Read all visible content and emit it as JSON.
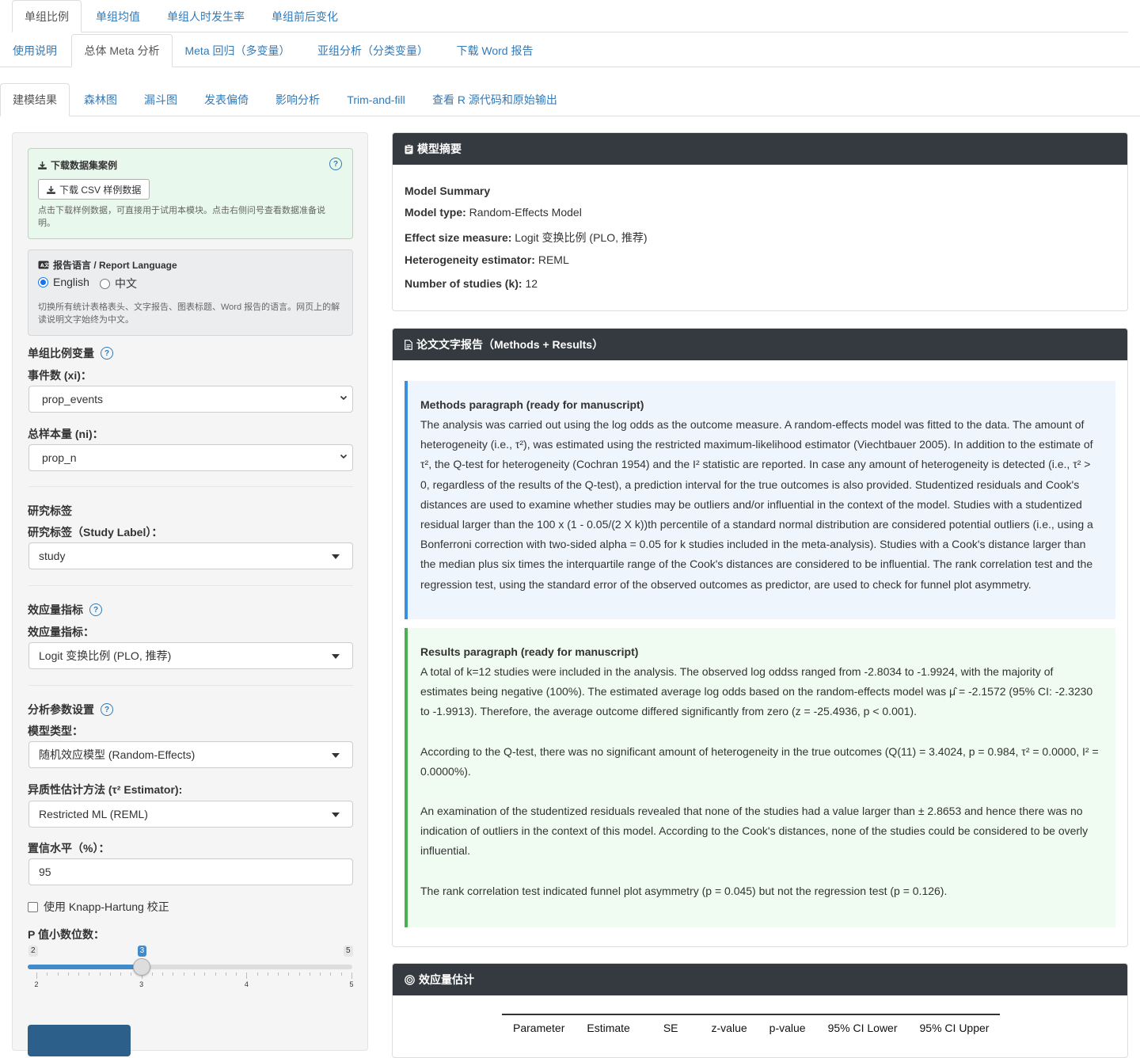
{
  "top_tabs": [
    "单组比例",
    "单组均值",
    "单组人时发生率",
    "单组前后变化"
  ],
  "second_tabs": [
    "使用说明",
    "总体 Meta 分析",
    "Meta 回归（多变量）",
    "亚组分析（分类变量）",
    "下载 Word 报告"
  ],
  "third_tabs": [
    "建模结果",
    "森林图",
    "漏斗图",
    "发表偏倚",
    "影响分析",
    "Trim-and-fill",
    "查看 R 源代码和原始输出"
  ],
  "sidebar": {
    "download_card": {
      "title": "下载数据集案例",
      "button": "下载 CSV 样例数据",
      "note": "点击下载样例数据，可直接用于试用本模块。点击右侧问号查看数据准备说明。"
    },
    "language_card": {
      "title": "报告语言 / Report Language",
      "options": [
        "English",
        "中文"
      ],
      "selected": "English",
      "note": "切换所有统计表格表头、文字报告、图表标题、Word 报告的语言。网页上的解读说明文字始终为中文。"
    },
    "var_section": "单组比例变量",
    "events_label": "事件数 (xi)：",
    "events_value": "prop_events",
    "n_label": "总样本量 (ni)：",
    "n_value": "prop_n",
    "study_section": "研究标签",
    "study_label": "研究标签（Study Label）：",
    "study_value": "study",
    "es_section": "效应量指标",
    "es_label": "效应量指标：",
    "es_value": "Logit 变换比例 (PLO, 推荐)",
    "param_section": "分析参数设置",
    "model_label": "模型类型：",
    "model_value": "随机效应模型 (Random-Effects)",
    "tau_label": "异质性估计方法 (τ² Estimator):",
    "tau_value": "Restricted ML (REML)",
    "ci_label": "置信水平（%）：",
    "ci_value": "95",
    "kh_label": "使用 Knapp-Hartung 校正",
    "kh_checked": false,
    "p_digits_label": "P 值小数位数：",
    "slider": {
      "min": 2,
      "max": 5,
      "value": 3,
      "ticks": [
        "2",
        "3",
        "4",
        "5"
      ],
      "min_label": "2",
      "max_label": "5",
      "value_label": "3"
    }
  },
  "summary_panel": {
    "title": "模型摘要",
    "heading": "Model Summary",
    "lines": [
      {
        "label": "Model type:",
        "value": " Random-Effects Model"
      },
      {
        "label": "Effect size measure:",
        "value": " Logit 变换比例 (PLO, 推荐)"
      },
      {
        "label": "Heterogeneity estimator:",
        "value": " REML"
      },
      {
        "label": "Number of studies (k):",
        "value": " 12"
      }
    ]
  },
  "report_panel": {
    "title": "论文文字报告（Methods + Results）",
    "methods_title": "Methods paragraph (ready for manuscript)",
    "methods_text": " The analysis was carried out using the log odds as the outcome measure. A random-effects model was fitted to the data. The amount of heterogeneity (i.e., τ²), was estimated using the restricted maximum-likelihood estimator (Viechtbauer 2005). In addition to the estimate of τ², the Q-test for heterogeneity (Cochran 1954) and the I² statistic are reported. In case any amount of heterogeneity is detected (i.e., τ² > 0, regardless of the results of the Q-test), a prediction interval for the true outcomes is also provided. Studentized residuals and Cook's distances are used to examine whether studies may be outliers and/or influential in the context of the model. Studies with a studentized residual larger than the 100 x (1 - 0.05/(2 X k))th percentile of a standard normal distribution are considered potential outliers (i.e., using a Bonferroni correction with two-sided alpha = 0.05 for k studies included in the meta-analysis). Studies with a Cook's distance larger than the median plus six times the interquartile range of the Cook's distances are considered to be influential. The rank correlation test and the regression test, using the standard error of the observed outcomes as predictor, are used to check for funnel plot asymmetry.",
    "results_title": "Results paragraph (ready for manuscript)",
    "results_paragraphs": [
      "A total of k=12 studies were included in the analysis. The observed log oddss ranged from -2.8034 to -1.9924, with the majority of estimates being negative (100%). The estimated average log odds based on the random-effects model was μ̂ = -2.1572 (95% CI: -2.3230 to -1.9913). Therefore, the average outcome differed significantly from zero (z = -25.4936, p < 0.001).",
      "According to the Q-test, there was no significant amount of heterogeneity in the true outcomes (Q(11) = 3.4024, p = 0.984, τ² = 0.0000, I² = 0.0000%).",
      "An examination of the studentized residuals revealed that none of the studies had a value larger than ± 2.8653 and hence there was no indication of outliers in the context of this model. According to the Cook's distances, none of the studies could be considered to be overly influential.",
      "The rank correlation test indicated funnel plot asymmetry (p = 0.045) but not the regression test (p = 0.126)."
    ]
  },
  "estimate_panel": {
    "title": "效应量估计",
    "columns": [
      "Parameter",
      "Estimate",
      "SE",
      "z-value",
      "p-value",
      "95% CI Lower",
      "95% CI Upper"
    ]
  },
  "colors": {
    "accent": "#337ab7",
    "panel_head": "#343a40",
    "methods_bg": "#eef5fd",
    "results_bg": "#f0fbf1"
  }
}
